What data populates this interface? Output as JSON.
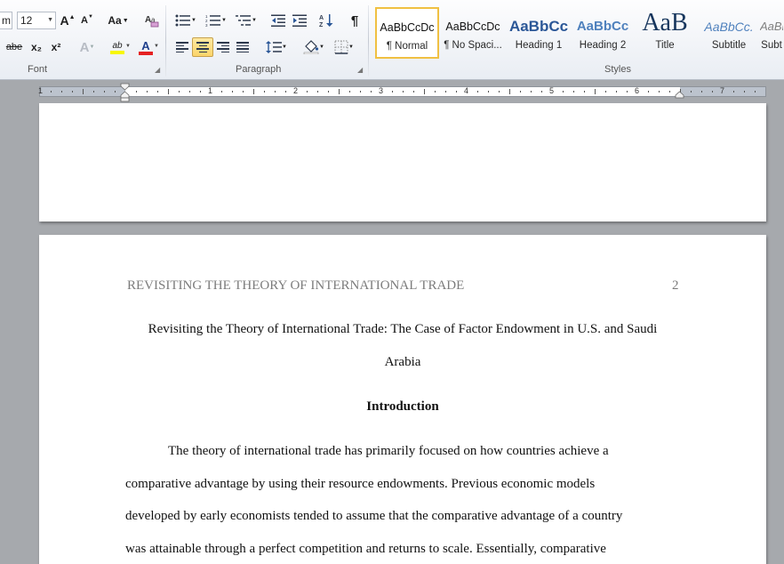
{
  "ribbon": {
    "font_group": {
      "label": "Font",
      "font_name_partial": "m",
      "font_size": "12",
      "grow_label": "A",
      "shrink_label": "A",
      "change_case_label": "Aa",
      "strike_label": "abe",
      "subscript_label": "x₂",
      "superscript_label": "x²",
      "text_effects_label": "A",
      "highlight_label": "ab",
      "font_color_label": "A",
      "clear_label": "A"
    },
    "paragraph_group": {
      "label": "Paragraph",
      "sort_label": "A↓Z",
      "pilcrow_label": "¶"
    },
    "styles_group": {
      "label": "Styles",
      "items": [
        {
          "sample": "AaBbCcDc",
          "name": "¶ Normal"
        },
        {
          "sample": "AaBbCcDc",
          "name": "¶ No Spaci..."
        },
        {
          "sample": "AaBbCc",
          "name": "Heading 1"
        },
        {
          "sample": "AaBbCc",
          "name": "Heading 2"
        },
        {
          "sample": "AaB",
          "name": "Title"
        },
        {
          "sample": "AaBbCc.",
          "name": "Subtitle"
        },
        {
          "sample": "AaBb",
          "name": "Subt"
        }
      ]
    },
    "colors": {
      "highlight": "#f7f700",
      "font_color": "#e52222",
      "heading_blue": "#2b5797",
      "subtitle_blue": "#4f81bd"
    }
  },
  "ruler": {
    "numbers": [
      "1",
      "1",
      "2",
      "3",
      "4",
      "5",
      "6",
      "7"
    ]
  },
  "document": {
    "running_header": "REVISITING THE THEORY OF INTERNATIONAL TRADE",
    "page_number": "2",
    "title_line1": "Revisiting the Theory of International Trade: The Case of Factor Endowment in U.S. and Saudi",
    "title_line2": "Arabia",
    "heading": "Introduction",
    "body_lines": [
      "The theory of international trade has primarily  focused on how countries achieve a",
      "comparative advantage by using their resource endowments. Previous economic models",
      "developed by early economists tended to assume that the comparative advantage of a country",
      "was attainable through a perfect competition and returns to scale. Essentially, comparative"
    ]
  }
}
